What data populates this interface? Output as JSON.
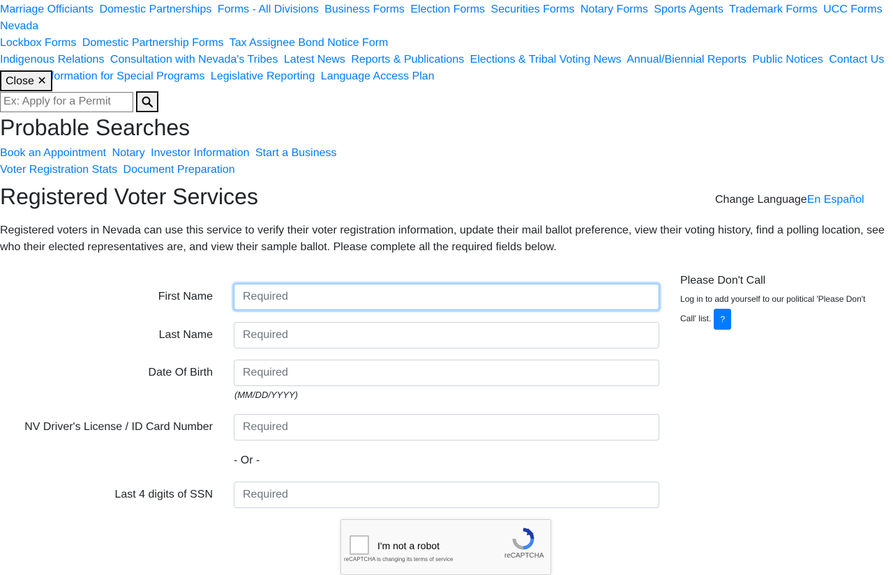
{
  "nav": {
    "rows": [
      [
        "Marriage Officiants",
        "Domestic Partnerships",
        "Forms - All Divisions",
        "Business Forms",
        "Election Forms",
        "Securities Forms",
        "Notary Forms",
        "Sports Agents",
        "Trademark Forms",
        "UCC Forms",
        "Nevada"
      ],
      [
        "Lockbox Forms",
        "Domestic Partnership Forms",
        "Tax Assignee Bond Notice Form"
      ],
      [
        "Indigenous Relations",
        "Consultation with Nevada's Tribes",
        "Latest News",
        "Reports & Publications",
        "Elections & Tribal Voting News",
        "Annual/Biennial Reports",
        "Public Notices",
        "Contact Us"
      ],
      [
        "Contact Information for Special Programs",
        "Legislative Reporting",
        "Language Access Plan"
      ]
    ]
  },
  "close_button": "Close ✕",
  "search": {
    "placeholder": "Ex: Apply for a Permit",
    "icon": "search-icon"
  },
  "probable": {
    "title": "Probable Searches",
    "rows": [
      [
        "Book an Appointment",
        "Notary",
        "Investor Information",
        "Start a Business"
      ],
      [
        "Voter Registration Stats",
        "Document Preparation"
      ]
    ]
  },
  "page": {
    "title": "Registered Voter Services",
    "language_img_alt": "Change Language",
    "language_link": "En Español",
    "intro": "Registered voters in Nevada can use this service to verify their voter registration information, update their mail ballot preference, view their voting history, find a polling location, see who their elected representatives are, and view their sample ballot. Please complete all the required fields below."
  },
  "form": {
    "first_name": {
      "label": "First Name",
      "placeholder": "Required"
    },
    "last_name": {
      "label": "Last Name",
      "placeholder": "Required"
    },
    "dob": {
      "label": "Date Of Birth",
      "placeholder": "Required",
      "hint": "(MM/DD/YYYY)"
    },
    "license": {
      "label": "NV Driver's License / ID Card Number",
      "placeholder": "Required"
    },
    "or_text": "- Or -",
    "ssn": {
      "label": "Last 4 digits of SSN",
      "placeholder": "Required"
    }
  },
  "recaptcha": {
    "label": "I'm not a robot",
    "brand": "reCAPTCHA",
    "note": "reCAPTCHA is changing its terms of service"
  },
  "sidebar": {
    "img_alt": "Please Don't Call",
    "text": "Log in to add yourself to our political 'Please Don't Call' list.",
    "help_label": "?"
  },
  "colors": {
    "link": "#007bff",
    "text": "#212529",
    "focus": "#80bdff"
  }
}
